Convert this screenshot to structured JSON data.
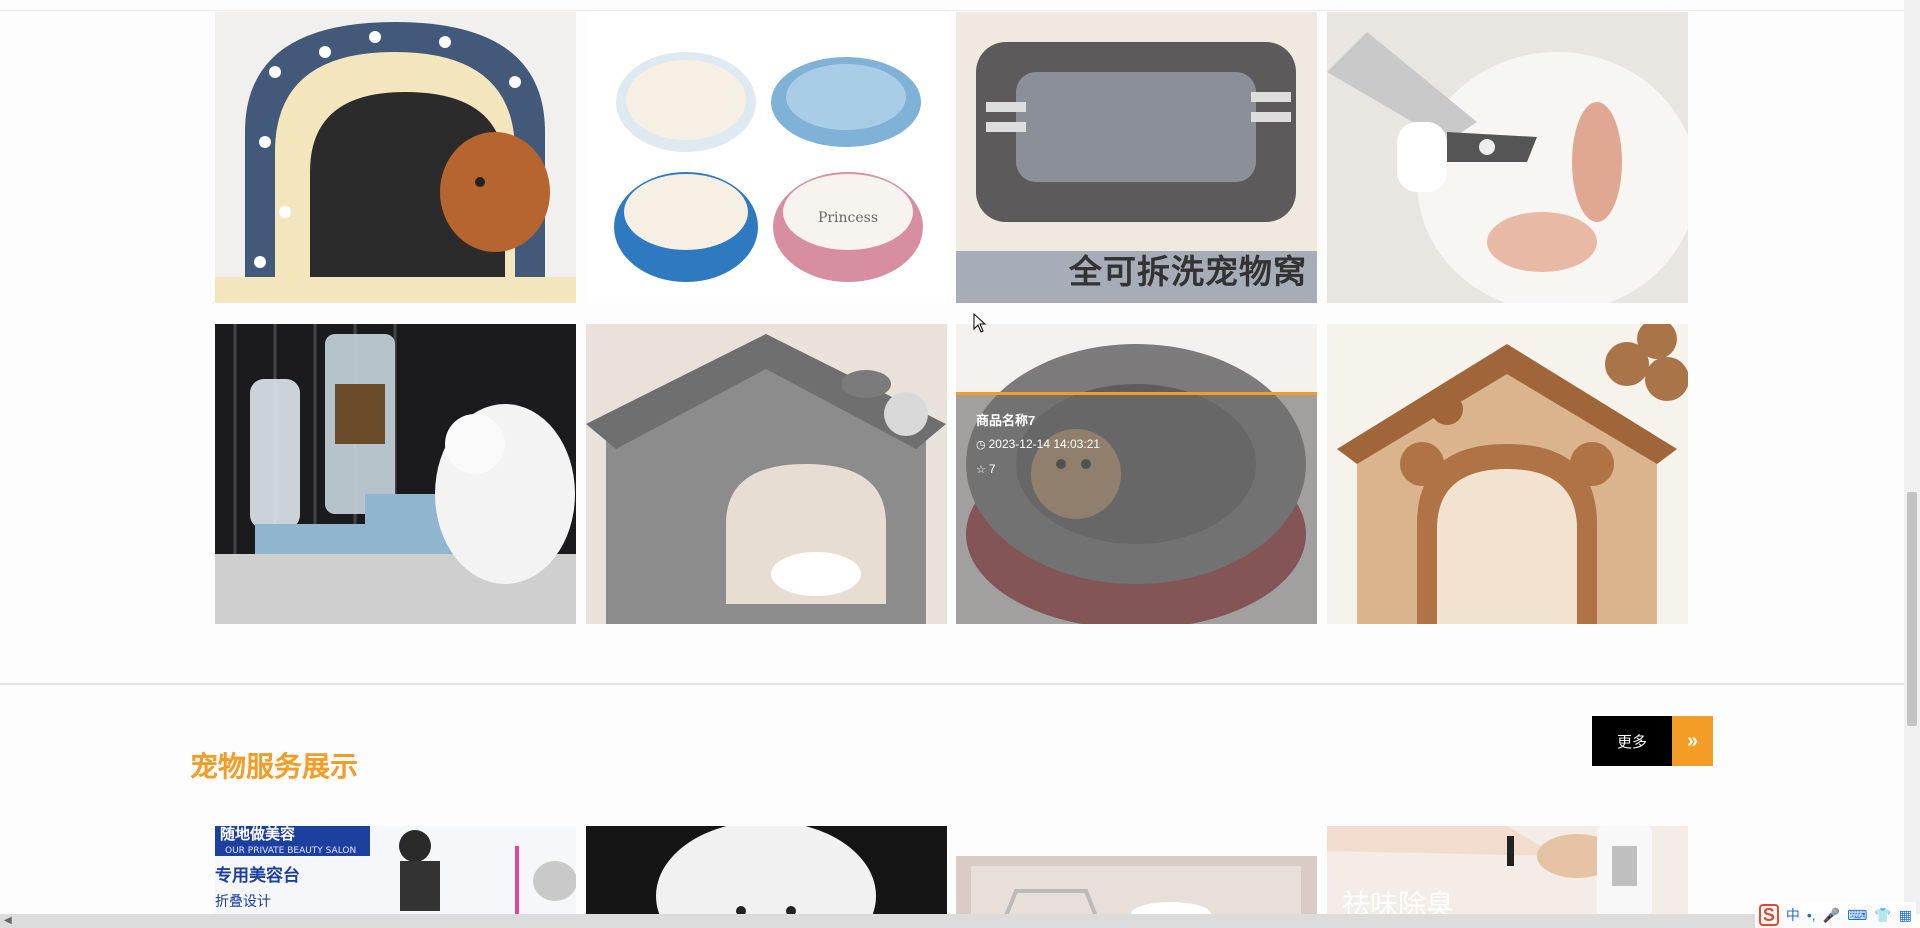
{
  "products_grid": {
    "row1": [
      {
        "image": "pet-house-star-pattern"
      },
      {
        "image": "cat-bowls-set"
      },
      {
        "image": "removable-pet-bed",
        "banner_text": "全可拆洗宠物窝"
      },
      {
        "image": "pet-nail-clipper"
      }
    ],
    "row2": [
      {
        "image": "auto-feeder-with-cat"
      },
      {
        "image": "grey-pet-house"
      },
      {
        "image": "round-cat-bed",
        "hover": {
          "name": "商品名称7",
          "date": "2023-12-14 14:03:21",
          "views": "7"
        }
      },
      {
        "image": "bear-pet-house"
      }
    ]
  },
  "services_section": {
    "title": "宠物服务展示",
    "more_label": "更多",
    "more_arrow": "»",
    "row": [
      {
        "image": "grooming-table-ad",
        "banner_lines": [
          "随地做美容",
          "OUR PRIVATE BEAUTY SALON",
          "专用美容台",
          "折叠设计"
        ]
      },
      {
        "image": "white-bichon-dog"
      },
      {
        "image": "pet-bath-tub"
      },
      {
        "image": "deodorant-spray",
        "overlay_text": "祛味除臭"
      }
    ]
  },
  "taskbar_ime": {
    "logo": "S",
    "items": [
      "中",
      "•,",
      "🎤",
      "⌨",
      "👕",
      "▦"
    ]
  },
  "colors": {
    "accent": "#f39c26",
    "button_dark": "#000000"
  }
}
